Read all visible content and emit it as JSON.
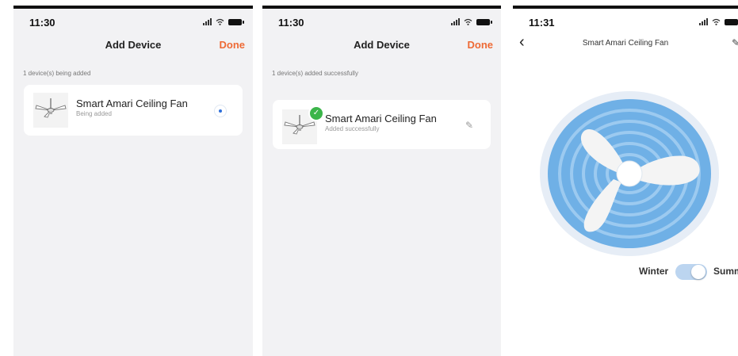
{
  "screen1": {
    "time": "11:30",
    "title": "Add Device",
    "done_label": "Done",
    "section_label": "1 device(s) being added",
    "device": {
      "name": "Smart Amari Ceiling Fan",
      "status": "Being added"
    }
  },
  "screen2": {
    "time": "11:30",
    "title": "Add Device",
    "done_label": "Done",
    "section_label": "1 device(s) added successfully",
    "device": {
      "name": "Smart Amari Ceiling Fan",
      "status": "Added successfully"
    }
  },
  "screen3": {
    "time": "11:31",
    "back_icon": "chevron-left-icon",
    "title": "Smart Amari Ceiling Fan",
    "mode_left": "Winter",
    "mode_right": "Summer",
    "mode_toggle_on": true
  },
  "colors": {
    "accent": "#ee6a35",
    "fan_blue": "#6fb0e6",
    "success": "#3bb54a",
    "spinner": "#2f6fda"
  }
}
